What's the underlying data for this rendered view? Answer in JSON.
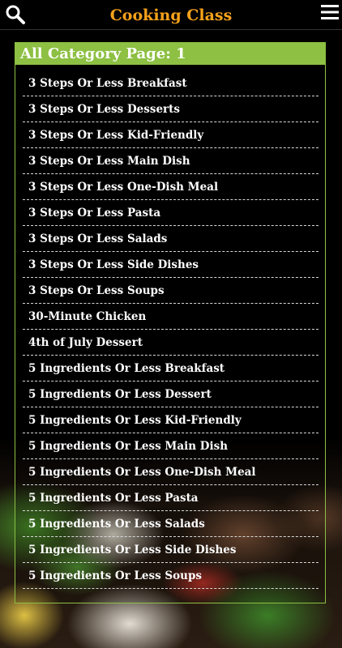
{
  "header": {
    "title": "Cooking Class",
    "search_icon": "search-icon",
    "menu_icon": "hamburger-menu-icon",
    "title_color": "#f7a21b"
  },
  "panel": {
    "heading": "All Category Page: 1",
    "accent_color": "#8dc043",
    "items": [
      {
        "label": "3 Steps Or Less Breakfast"
      },
      {
        "label": "3 Steps Or Less Desserts"
      },
      {
        "label": "3 Steps Or Less Kid-Friendly"
      },
      {
        "label": "3 Steps Or Less Main Dish"
      },
      {
        "label": "3 Steps Or Less One-Dish Meal"
      },
      {
        "label": "3 Steps Or Less Pasta"
      },
      {
        "label": "3 Steps Or Less Salads"
      },
      {
        "label": "3 Steps Or Less Side Dishes"
      },
      {
        "label": "3 Steps Or Less Soups"
      },
      {
        "label": "30-Minute Chicken"
      },
      {
        "label": "4th of July Dessert"
      },
      {
        "label": "5 Ingredients Or Less Breakfast"
      },
      {
        "label": "5 Ingredients Or Less Dessert"
      },
      {
        "label": "5 Ingredients Or Less Kid-Friendly"
      },
      {
        "label": "5 Ingredients Or Less Main Dish"
      },
      {
        "label": "5 Ingredients Or Less One-Dish Meal"
      },
      {
        "label": "5 Ingredients Or Less Pasta"
      },
      {
        "label": "5 Ingredients Or Less Salads"
      },
      {
        "label": "5 Ingredients Or Less Side Dishes"
      },
      {
        "label": "5 Ingredients Or Less Soups"
      }
    ]
  }
}
